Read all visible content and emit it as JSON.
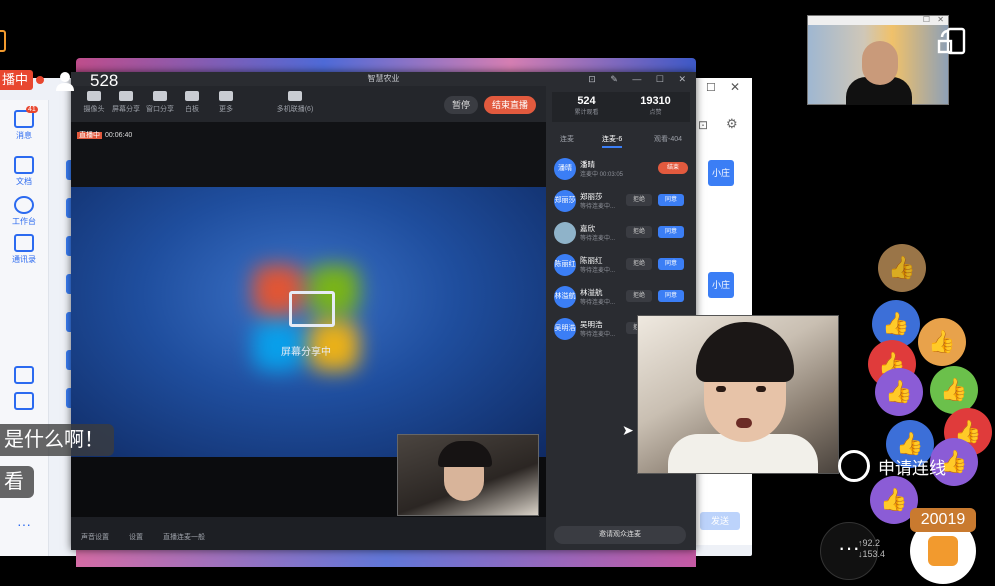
{
  "overlay": {
    "live_tag": "播中",
    "viewer_count": "528",
    "comments": [
      "是什么啊！",
      "看"
    ],
    "apply_connect": "申请连线",
    "like_count": "20019",
    "net_speed_up": "↑92.2",
    "net_speed_down": "↓153.4"
  },
  "bg_app": {
    "sidebar": [
      {
        "label": "消息",
        "badge": "41"
      },
      {
        "label": "文档"
      },
      {
        "label": "工作台"
      },
      {
        "label": "通讯录"
      }
    ],
    "side_btn_1": "小庄",
    "side_btn_2": "小庄",
    "send_label": "发送"
  },
  "window": {
    "title": "智慧农业",
    "tools": [
      "摄像头",
      "屏幕分享",
      "窗口分享",
      "白板",
      "更多",
      "多机联播(6)"
    ],
    "pause": "暂停",
    "end_live": "结束直播",
    "live_badge": "直播中",
    "live_timer": "00:06:40",
    "screen_share": "屏幕分享中",
    "status": [
      "声音设置",
      "设置",
      "直播连麦一般"
    ]
  },
  "panel": {
    "likes": "524",
    "likes_label": "累计观看",
    "viewers": "19310",
    "viewers_label": "点赞",
    "tabs": [
      "连麦",
      "连麦-6",
      "观看-404"
    ],
    "people": [
      {
        "avatar": "潘晴",
        "name": "潘晴",
        "status": "连麦中 00:03:05",
        "action": "结束"
      },
      {
        "avatar": "郑丽莎",
        "name": "郑丽莎",
        "status": "等待连麦中...",
        "reject": "拒绝",
        "accept": "同意"
      },
      {
        "avatar": "",
        "name": "嘉欣",
        "status": "等待连麦中...",
        "reject": "拒绝",
        "accept": "同意"
      },
      {
        "avatar": "陈丽红",
        "name": "陈丽红",
        "status": "等待连麦中...",
        "reject": "拒绝",
        "accept": "同意"
      },
      {
        "avatar": "林溢航",
        "name": "林溢航",
        "status": "等待连麦中...",
        "reject": "拒绝",
        "accept": "同意"
      },
      {
        "avatar": "吴明浩",
        "name": "吴明浩",
        "status": "等待连麦中...",
        "reject": "拒绝",
        "accept": ""
      }
    ],
    "invite": "邀请观众连麦"
  }
}
